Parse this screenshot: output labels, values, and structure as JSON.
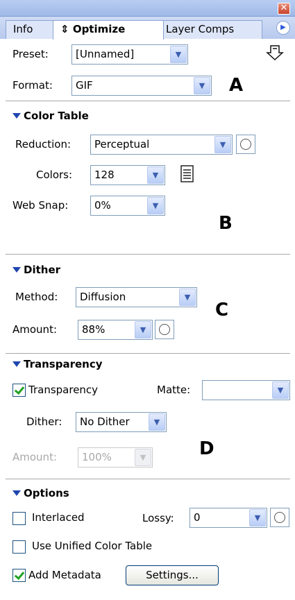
{
  "tabs": {
    "info": "Info",
    "optimize": "Optimize",
    "layer_comps": "Layer Comps",
    "optimize_icon": "⇕"
  },
  "preset": {
    "label": "Preset:",
    "value": "[Unnamed]"
  },
  "format": {
    "label": "Format:",
    "value": "GIF"
  },
  "color_table": {
    "header": "Color Table",
    "reduction": {
      "label": "Reduction:",
      "value": "Perceptual"
    },
    "colors": {
      "label": "Colors:",
      "value": "128"
    },
    "web_snap": {
      "label": "Web Snap:",
      "value": "0%"
    }
  },
  "dither": {
    "header": "Dither",
    "method": {
      "label": "Method:",
      "value": "Diffusion"
    },
    "amount": {
      "label": "Amount:",
      "value": "88%"
    }
  },
  "transparency": {
    "header": "Transparency",
    "checkbox_label": "Transparency",
    "checked": true,
    "matte": {
      "label": "Matte:",
      "value": ""
    },
    "dither": {
      "label": "Dither:",
      "value": "No Dither"
    },
    "amount": {
      "label": "Amount:",
      "value": "100%"
    }
  },
  "options": {
    "header": "Options",
    "interlaced": {
      "label": "Interlaced",
      "checked": false
    },
    "lossy": {
      "label": "Lossy:",
      "value": "0"
    },
    "unified": {
      "label": "Use Unified Color Table",
      "checked": false
    },
    "metadata": {
      "label": "Add Metadata",
      "checked": true
    },
    "settings_button": "Settings..."
  },
  "annotations": {
    "a": "A",
    "b": "B",
    "c": "C",
    "d": "D"
  },
  "icons": [
    "close-icon",
    "panel-menu-icon",
    "preset-menu-icon",
    "color-table-icon",
    "dither-mask-icon",
    "lossy-mask-icon",
    "reduction-mask-icon"
  ],
  "colors": {
    "accent": "#2046b0",
    "titlebar": "#a7c0ec",
    "checkmark": "#21a121"
  }
}
